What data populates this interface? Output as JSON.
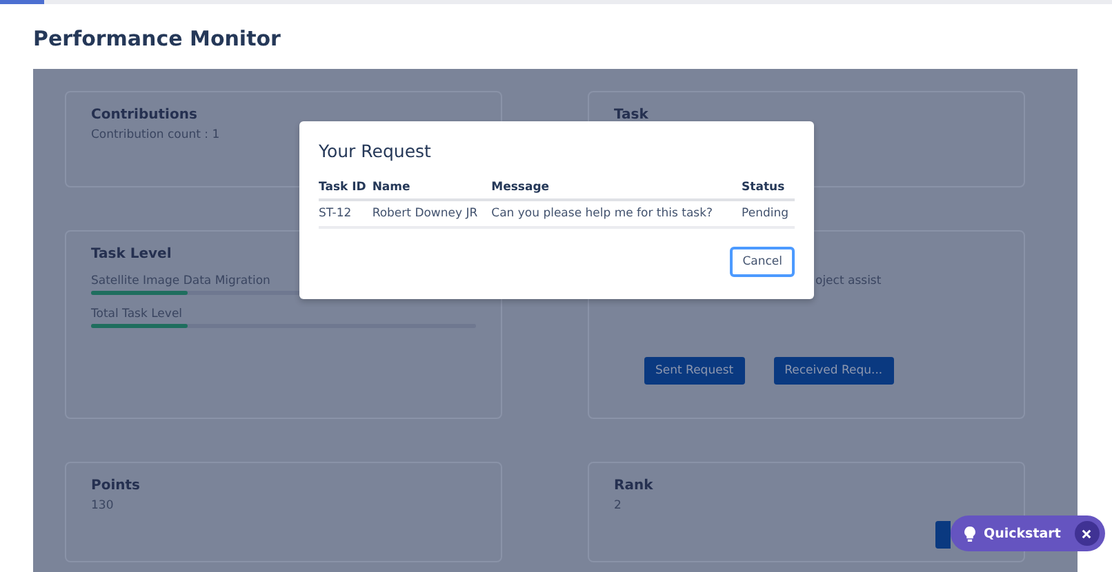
{
  "page": {
    "title": "Performance Monitor"
  },
  "cards": [
    {
      "kind": "stat",
      "title": "Contributions",
      "value": "Contribution count : 1"
    },
    {
      "kind": "stat",
      "title": "Task"
    },
    {
      "kind": "levels",
      "title": "Task Level",
      "bars": [
        {
          "label": "Satellite Image Data Migration",
          "level": 0.25
        },
        {
          "label": "Total Task Level",
          "level": 0.25
        }
      ]
    },
    {
      "kind": "requests",
      "text": "oject assist",
      "buttons": [
        "Sent Request",
        "Received Requ..."
      ]
    },
    {
      "kind": "stat",
      "title": "Points",
      "value": "130"
    },
    {
      "kind": "stat",
      "title": "Rank",
      "value": "2",
      "partial_button": true
    }
  ],
  "modal": {
    "title": "Your Request",
    "columns": [
      "Task ID",
      "Name",
      "Message",
      "Status"
    ],
    "rows": [
      [
        "ST-12",
        "Robert Downey JR",
        "Can you please help me for this task?",
        "Pending"
      ]
    ],
    "button": "Cancel"
  },
  "quickstart": {
    "label": "Quickstart"
  }
}
